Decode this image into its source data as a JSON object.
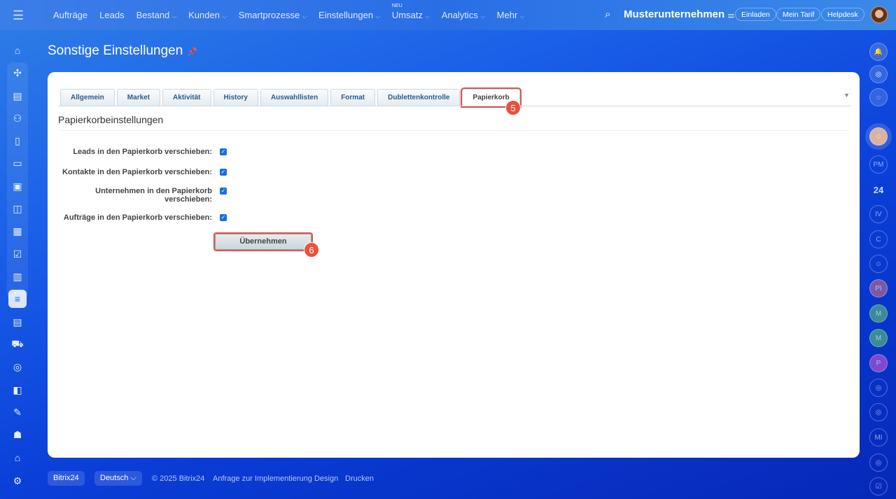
{
  "topbar": {
    "nav": [
      {
        "label": "Aufträge",
        "dropdown": false
      },
      {
        "label": "Leads",
        "dropdown": false
      },
      {
        "label": "Bestand",
        "dropdown": true
      },
      {
        "label": "Kunden",
        "dropdown": true
      },
      {
        "label": "Smartprozesse",
        "dropdown": true
      },
      {
        "label": "Einstellungen",
        "dropdown": true
      },
      {
        "label": "Umsatz",
        "dropdown": true,
        "badge": "NEU"
      },
      {
        "label": "Analytics",
        "dropdown": true
      },
      {
        "label": "Mehr",
        "dropdown": true
      }
    ],
    "company": "Musterunternehmen",
    "invite": "Einladen",
    "plan": "Mein Tarif",
    "helpdesk": "Helpdesk"
  },
  "page": {
    "title": "Sonstige Einstellungen"
  },
  "tabs": [
    {
      "label": "Allgemein"
    },
    {
      "label": "Market"
    },
    {
      "label": "Aktivität"
    },
    {
      "label": "History"
    },
    {
      "label": "Auswahllisten"
    },
    {
      "label": "Format"
    },
    {
      "label": "Dublettenkontrolle"
    },
    {
      "label": "Papierkorb",
      "selected": true
    }
  ],
  "annotations": {
    "tab_step": "5",
    "button_step": "6",
    "highlight_color": "#e05454"
  },
  "section": {
    "title": "Papierkorbeinstellungen",
    "options": [
      {
        "label": "Leads in den Papierkorb verschieben:",
        "checked": true
      },
      {
        "label": "Kontakte in den Papierkorb verschieben:",
        "checked": true
      },
      {
        "label": "Unternehmen in den Papierkorb verschieben:",
        "checked": true
      },
      {
        "label": "Aufträge in den Papierkorb verschieben:",
        "checked": true
      }
    ],
    "apply": "Übernehmen"
  },
  "right_sidebar": [
    "bell",
    "copilot",
    "chat",
    "avatar",
    "PM",
    "24",
    "IV",
    "C",
    "avatar",
    "PI",
    "M",
    "M",
    "P",
    "copilot",
    "copilot",
    "MI",
    "copilot",
    "task"
  ],
  "footer": {
    "brand": "Bitrix24",
    "language": "Deutsch",
    "copyright": "© 2025 Bitrix24",
    "links": [
      "Anfrage zur Implementierung",
      "Design",
      "Drucken"
    ]
  }
}
